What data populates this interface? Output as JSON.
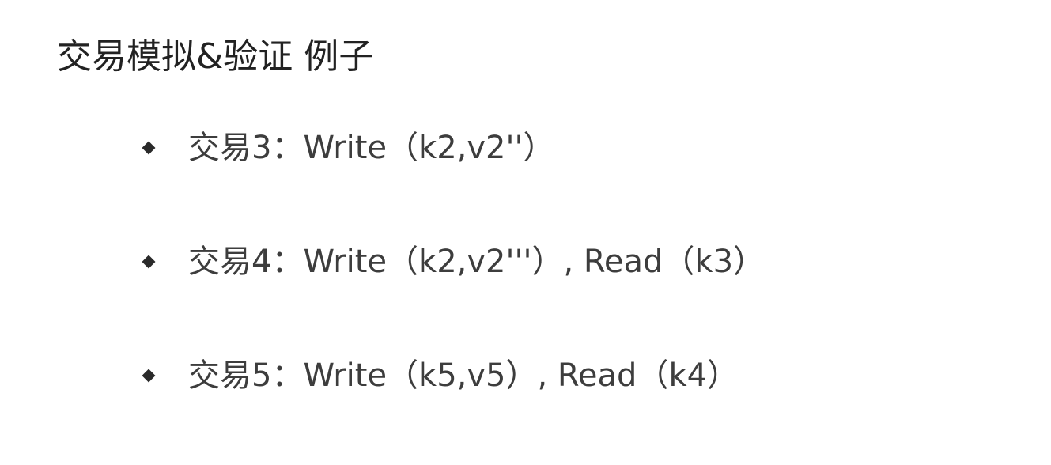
{
  "slide": {
    "title": "交易模拟&验证 例子",
    "bullets": [
      {
        "text": "交易3：Write（k2,v2''）"
      },
      {
        "text": "交易4：Write（k2,v2'''）, Read（k3）"
      },
      {
        "text": "交易5：Write（k5,v5）, Read（k4）"
      }
    ],
    "bullet_icon": "diamond-bullet-icon",
    "colors": {
      "background": "#ffffff",
      "title": "#222222",
      "text": "#3d3d3d"
    }
  }
}
